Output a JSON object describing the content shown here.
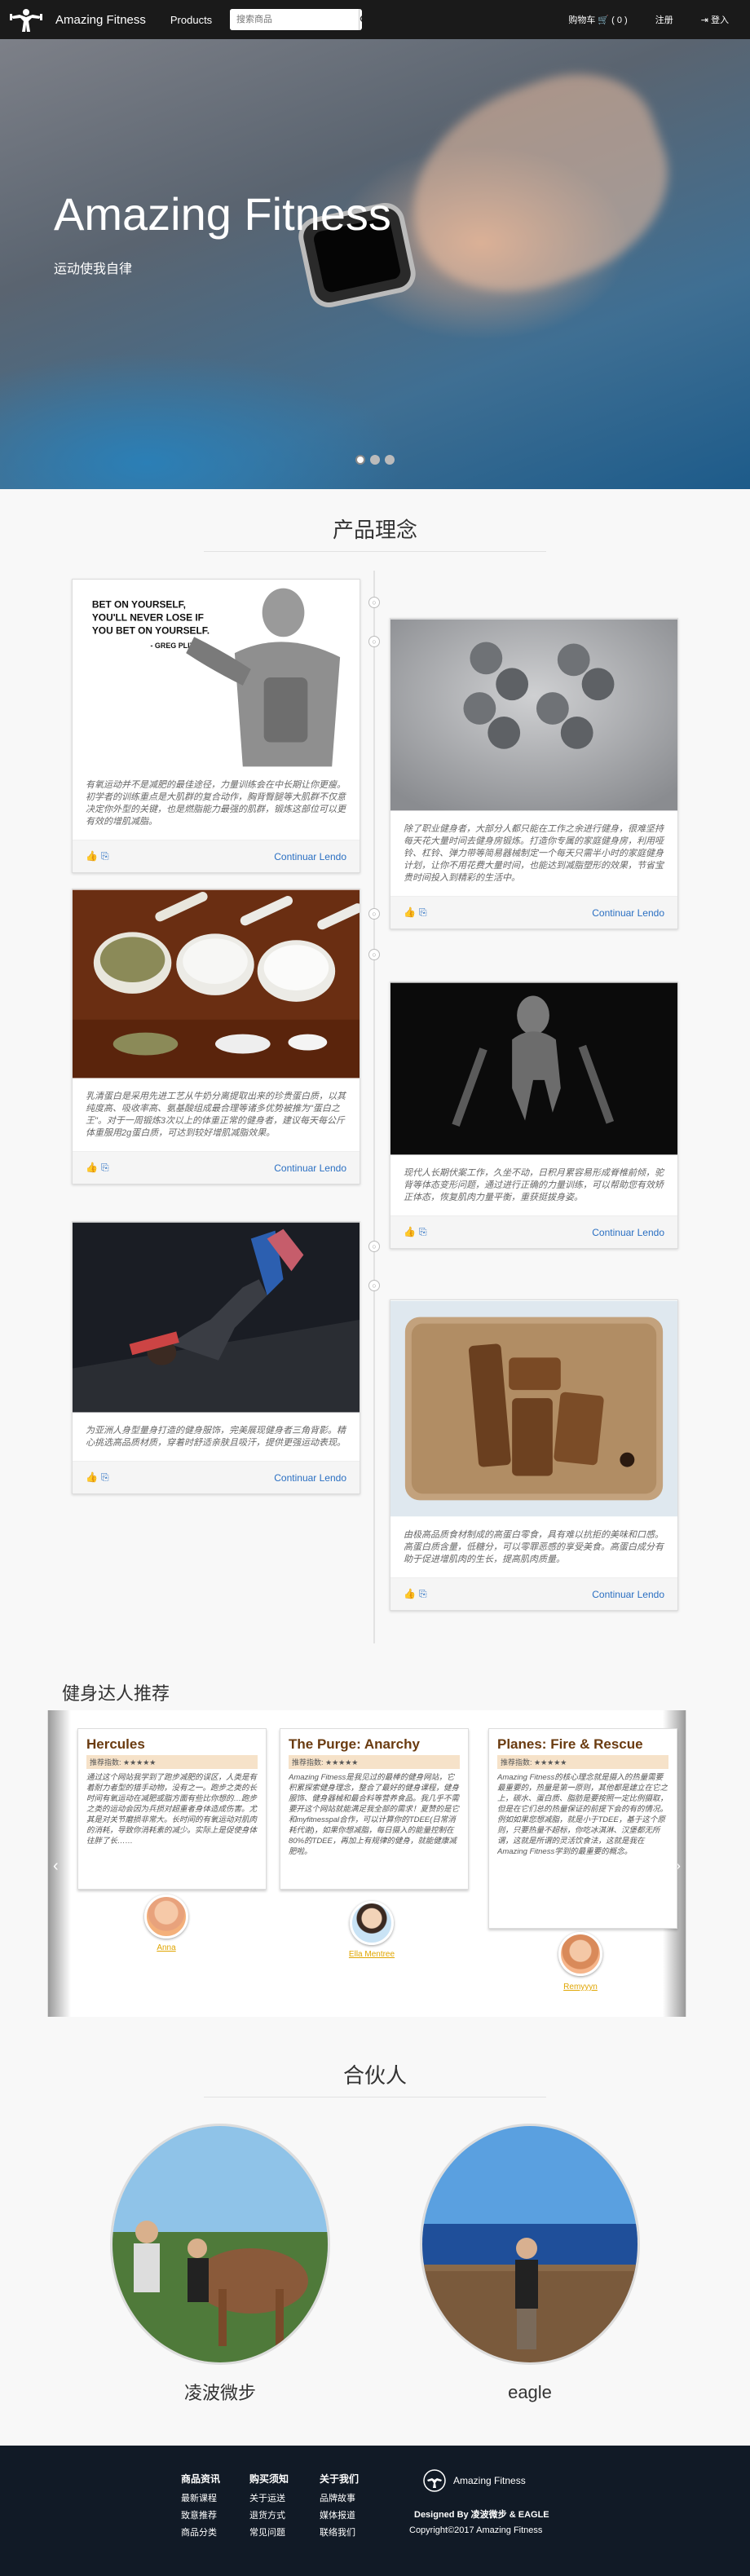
{
  "navbar": {
    "brand": "Amazing Fitness",
    "products": "Products",
    "search_placeholder": "搜索商品",
    "cart": "购物车 🛒 ( 0 )",
    "register": "注册",
    "login": "⇥ 登入"
  },
  "hero": {
    "title": "Amazing Fitness",
    "subtitle": "运动使我自律",
    "slides": 3,
    "active_slide": 1
  },
  "philosophy": {
    "title": "产品理念",
    "more_label": "Continuar Lendo",
    "poster_text": "BET ON YOURSELF, YOU'LL NEVER LOSE IF YOU BET ON YOURSELF. - GREG PLITT",
    "cards": [
      {
        "text": "有氧运动并不是减肥的最佳途径，力量训练会在中长期让你更瘦。初学者的训练重点是大肌群的复合动作，胸背臀腿等大肌群不仅意决定你外型的关键，也是燃脂能力最强的肌群，锻炼这部位可以更有效的增肌减脂。"
      },
      {
        "text": "除了职业健身者，大部分人都只能在工作之余进行健身，很难坚持每天花大量时间去健身房锻炼。打造你专属的家庭健身房，利用哑铃、杠铃、弹力带等简易器械制定一个每天只需半小时的家庭健身计划，让你不用花费大量时间，也能达到减脂塑形的效果，节省宝贵时间投入到精彩的生活中。"
      },
      {
        "text": "乳清蛋白是采用先进工艺从牛奶分离提取出来的珍贵蛋白质，以其纯度高、吸收率高、氨基酸组成最合理等诸多优势被推为\"蛋白之王\"。对于一周锻炼3次以上的体重正常的健身者，建议每天每公斤体重服用2g蛋白质，可达到较好增肌减脂效果。"
      },
      {
        "text": "现代人长期伏案工作，久坐不动，日积月累容易形成脊椎前倾，驼背等体态变形问题，通过进行正确的力量训练，可以帮助您有效矫正体态，恢复肌肉力量平衡，重获挺拔身姿。"
      },
      {
        "text": "为亚洲人身型量身打造的健身服饰，完美展现健身者三角背影。精心挑选高品质材质，穿着时舒适亲肤且吸汗，提供更强运动表现。"
      },
      {
        "text": "由极高品质食材制成的高蛋白零食，具有难以抗拒的美味和口感。高蛋白质含量，低糖分，可以零罪恶感的享受美食。高蛋白成分有助于促进增肌肉的生长，提高肌肉质量。"
      }
    ]
  },
  "recommend": {
    "title": "健身达人推荐",
    "rating_label": "推荐指数: ★★★★★",
    "items": [
      {
        "name": "Hercules",
        "text": "通过这个网站我学到了跑步减肥的误区，人类是有着耐力者型的猎手动物，没有之一。跑步之类的长时间有氧运动在减肥或脂方面有些比你想的…跑步之类的运动会因为兵损对超重者身体造成伤害。尤其是对关节磨损非常大。长时间的有氧运动对肌肉的消耗，导致你消耗素的减少。实际上是促使身体往胖了长……",
        "user": "Anna"
      },
      {
        "name": "The Purge: Anarchy",
        "text": "Amazing Fitness是我见过的最棒的健身网站，它积累探索健身理念，整合了最好的健身课程，健身服饰、健身器械和最合料等营养食品。我几乎不需要开这个网站就能满足我全部的需求！夏赞的是它和myfitnesspal合作，可以计算你的TDEE(日常消耗代谢)，如果你想减脂，每日摄入的能量控制在80%的TDEE，再加上有规律的健身，就能健康减肥啦。",
        "user": "Ella Mentree"
      },
      {
        "name": "Planes: Fire & Rescue",
        "text": "Amazing Fitness的核心理念就是摄入的热量需要最重要的，热量是第一原则，其他都是建立在它之上，碳水、蛋白质、脂肪是要按照一定比例摄取，但是在它们总的热量保证的前提下会的有的情况。例如如果您想减脂，就是小于TDEE，基于这个原则，只要热量不超标，你吃冰淇淋、汉堡都无所谓，这就是所谓的灵活饮食法，这就是我在Amazing Fitness学到的最重要的概念。",
        "user": "Remyyyn"
      }
    ]
  },
  "partners": {
    "title": "合伙人",
    "items": [
      {
        "name": "凌波微步"
      },
      {
        "name": "eagle"
      }
    ]
  },
  "footer": {
    "col1": {
      "title": "商品资讯",
      "links": [
        "最新课程",
        "致意推荐",
        "商品分类"
      ]
    },
    "col2": {
      "title": "购买须知",
      "links": [
        "关于运送",
        "退货方式",
        "常见问题"
      ]
    },
    "col3": {
      "title": "关于我们",
      "links": [
        "品牌故事",
        "媒体报道",
        "联络我们"
      ]
    },
    "brand": "Amazing Fitness",
    "designed": "Designed By 凌波微步 & EAGLE",
    "copyright": "Copyright©2017 Amazing Fitness"
  },
  "colors": {
    "navbar": "#1a1a1a",
    "footer": "#111a26",
    "link": "#2a6fc2",
    "recommend_title": "#6a3b10",
    "user_link": "#e0a500"
  }
}
